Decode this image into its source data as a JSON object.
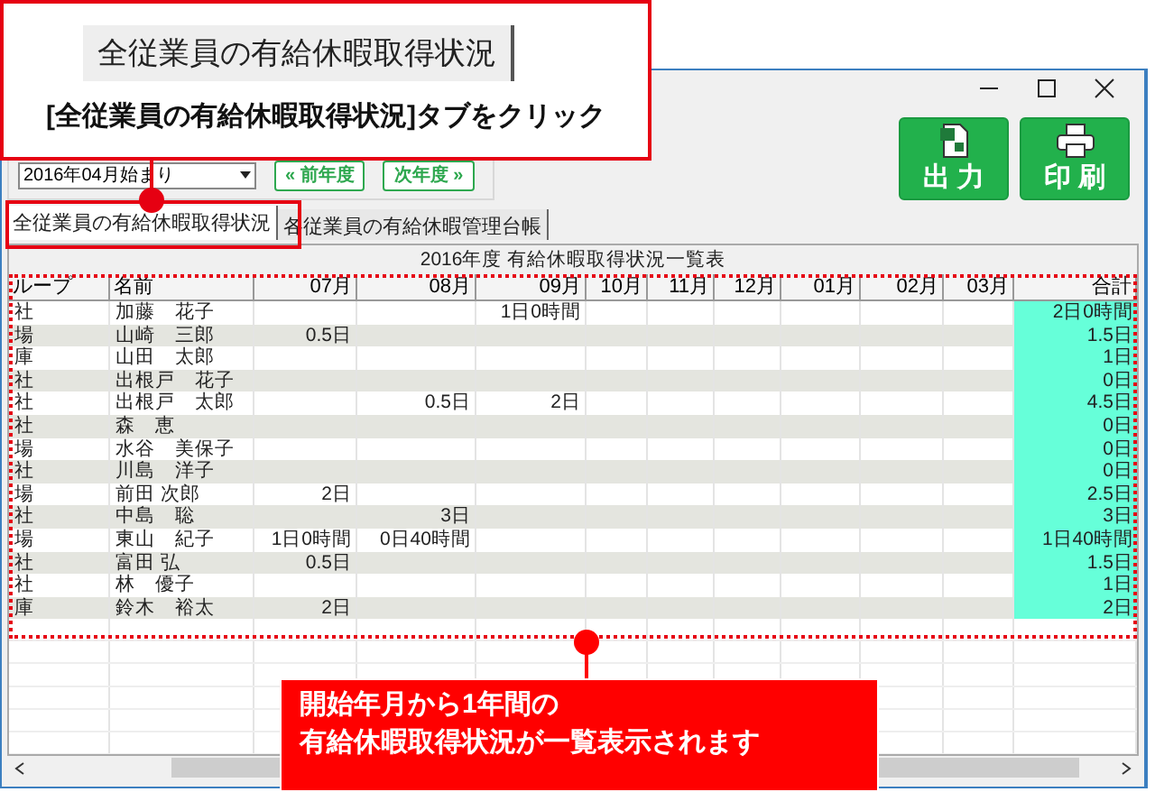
{
  "top_callout": {
    "tab_label": "全従業員の有給休暇取得状況",
    "text": "[全従業員の有給休暇取得状況]タブをクリック"
  },
  "toolbar": {
    "start_month": "2016年04月始まり",
    "prev_button": "« 前年度",
    "next_button": "次年度 »",
    "output_button": "出 力",
    "print_button": "印 刷"
  },
  "tabs": [
    {
      "label": "全従業員の有給休暇取得状況",
      "selected": true
    },
    {
      "label": "各従業員の有給休暇管理台帳",
      "selected": false
    }
  ],
  "table": {
    "title": "2016年度 有給休暇取得状況一覧表",
    "columns": [
      "ループ",
      "名前",
      "07月",
      "08月",
      "09月",
      "10月",
      "11月",
      "12月",
      "01月",
      "02月",
      "03月",
      "合計"
    ],
    "rows": [
      {
        "group": "社",
        "name": "加藤　花子",
        "months": {
          "m09": "1日0時間"
        },
        "total": "2日0時間"
      },
      {
        "group": "場",
        "name": "山崎　三郎",
        "months": {
          "m07": "0.5日"
        },
        "total": "1.5日"
      },
      {
        "group": "庫",
        "name": "山田　太郎",
        "total": "1日"
      },
      {
        "group": "社",
        "name": "出根戸　花子",
        "total": "0日"
      },
      {
        "group": "社",
        "name": "出根戸　太郎",
        "months": {
          "m08": "0.5日",
          "m09": "2日"
        },
        "total": "4.5日"
      },
      {
        "group": "社",
        "name": "森　恵",
        "total": "0日"
      },
      {
        "group": "場",
        "name": "水谷　美保子",
        "total": "0日"
      },
      {
        "group": "社",
        "name": "川島　洋子",
        "total": "0日"
      },
      {
        "group": "場",
        "name": "前田 次郎",
        "months": {
          "m07": "2日"
        },
        "total": "2.5日"
      },
      {
        "group": "社",
        "name": "中島　聡",
        "months": {
          "m08": "3日"
        },
        "total": "3日"
      },
      {
        "group": "場",
        "name": "東山　紀子",
        "months": {
          "m07": "1日0時間",
          "m08": "0日40時間"
        },
        "total": "1日40時間"
      },
      {
        "group": "社",
        "name": "富田 弘",
        "months": {
          "m07": "0.5日"
        },
        "total": "1.5日"
      },
      {
        "group": "社",
        "name": "林　優子",
        "total": "1日"
      },
      {
        "group": "庫",
        "name": "鈴木　裕太",
        "months": {
          "m07": "2日"
        },
        "total": "2日"
      }
    ]
  },
  "bottom_callout": {
    "lines": [
      "開始年月から1年間の",
      "有給休暇取得状況が一覧表示されます"
    ]
  }
}
